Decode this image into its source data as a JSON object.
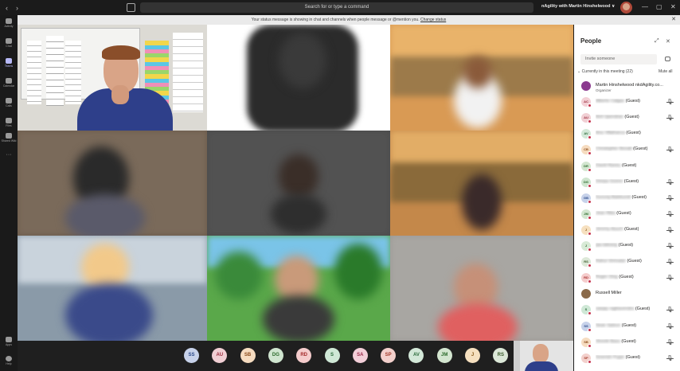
{
  "titlebar": {
    "search_placeholder": "Search for or type a command",
    "org_label": "nAgility with Martin Hinshelwood ∨",
    "back": "‹",
    "forward": "›",
    "minimize": "—",
    "maximize": "▢",
    "close": "✕"
  },
  "banner": {
    "text": "Your status message is showing in chat and channels when people message or @mention you.",
    "link": "Change status",
    "close": "✕"
  },
  "rail": [
    {
      "label": "Activity",
      "icon": "bell-icon"
    },
    {
      "label": "Chat",
      "icon": "chat-icon"
    },
    {
      "label": "Teams",
      "icon": "teams-icon"
    },
    {
      "label": "Calendar",
      "icon": "calendar-icon"
    },
    {
      "label": "Calls",
      "icon": "phone-icon"
    },
    {
      "label": "Files",
      "icon": "file-icon"
    },
    {
      "label": "Shared Wiki",
      "icon": "wiki-icon"
    },
    {
      "label": "···",
      "icon": "more-icon"
    },
    {
      "label": "Apps",
      "icon": "apps-icon"
    },
    {
      "label": "Help",
      "icon": "help-icon"
    }
  ],
  "participants_bar": [
    {
      "initials": "SS",
      "bg": "#c7d2ea",
      "fg": "#2b4a8a"
    },
    {
      "initials": "AU",
      "bg": "#f1cfd4",
      "fg": "#9b2b3c"
    },
    {
      "initials": "SB",
      "bg": "#f6dcc0",
      "fg": "#8a4a1a"
    },
    {
      "initials": "DG",
      "bg": "#cfe5cf",
      "fg": "#2a6a2a"
    },
    {
      "initials": "RD",
      "bg": "#f5cccc",
      "fg": "#a32a2a"
    },
    {
      "initials": "S",
      "bg": "#cfe8d6",
      "fg": "#2a6a3a"
    },
    {
      "initials": "SA",
      "bg": "#f3cfd9",
      "fg": "#9a2a4a"
    },
    {
      "initials": "SP",
      "bg": "#f3d0cc",
      "fg": "#a23a2a"
    },
    {
      "initials": "AV",
      "bg": "#d3e8d8",
      "fg": "#2a6a3a"
    },
    {
      "initials": "JM",
      "bg": "#d3e6d0",
      "fg": "#2a6a2a"
    },
    {
      "initials": "J",
      "bg": "#f6e0bf",
      "fg": "#8a5a1a"
    },
    {
      "initials": "RS",
      "bg": "#dce8d8",
      "fg": "#3a5a2a"
    }
  ],
  "people": {
    "title": "People",
    "invite_placeholder": "Invite someone",
    "section": "Currently in this meeting (22)",
    "mute_all": "Mute all",
    "rows": [
      {
        "initials": "",
        "name": "Martin Hinshelwood nkdAgility.co...",
        "sub": "Organizer",
        "clear": true,
        "bg": "#8b3a8f",
        "fg": "#fff",
        "mic": false
      },
      {
        "initials": "AC",
        "name": "Alberto Calgas",
        "suffix": "(Guest)",
        "bg": "#f3d0d6",
        "fg": "#9b2b3c",
        "mic": true
      },
      {
        "initials": "AU",
        "name": "Anil Upendran",
        "suffix": "(Guest)",
        "bg": "#f1cfd4",
        "fg": "#9b2b3c",
        "mic": true
      },
      {
        "initials": "AV",
        "name": "Ana Villafranca",
        "suffix": "(Guest)",
        "bg": "#d3e8d8",
        "fg": "#2a6a3a",
        "mic": false
      },
      {
        "initials": "CB",
        "name": "Christopher Bonalt",
        "suffix": "(Guest)",
        "bg": "#f6dcc0",
        "fg": "#8a4a1a",
        "mic": true
      },
      {
        "initials": "DR",
        "name": "David Raney",
        "suffix": "(Guest)",
        "bg": "#d3e6d0",
        "fg": "#2a6a2a",
        "mic": false
      },
      {
        "initials": "DG",
        "name": "Deepa Goene",
        "suffix": "(Guest)",
        "bg": "#cfe5cf",
        "fg": "#2a6a2a",
        "mic": true
      },
      {
        "initials": "GB",
        "name": "Gururaj Balekundi",
        "suffix": "(Guest)",
        "bg": "#c7d2ea",
        "fg": "#2b4a8a",
        "mic": true
      },
      {
        "initials": "JM",
        "name": "Jean Riba",
        "suffix": "(Guest)",
        "bg": "#d3e6d0",
        "fg": "#2a6a2a",
        "mic": true
      },
      {
        "initials": "J",
        "name": "Jeremy Asuch",
        "suffix": "(Guest)",
        "bg": "#f6e0bf",
        "fg": "#8a5a1a",
        "mic": true
      },
      {
        "initials": "J",
        "name": "jaa-lateang",
        "suffix": "(Guest)",
        "bg": "#d8ead6",
        "fg": "#2a6a2a",
        "mic": true
      },
      {
        "initials": "RS",
        "name": "Rahul Shrivatar",
        "suffix": "(Guest)",
        "bg": "#dce8d8",
        "fg": "#3a5a2a",
        "mic": true
      },
      {
        "initials": "RD",
        "name": "Roger Diog",
        "suffix": "(Guest)",
        "bg": "#f5cccc",
        "fg": "#a32a2a",
        "mic": true
      },
      {
        "initials": "",
        "name": "Russell Miller",
        "clear": true,
        "bg": "#8a6a4a",
        "fg": "#fff",
        "mic": false
      },
      {
        "initials": "S",
        "name": "sanjay raghavendra",
        "suffix": "(Guest)",
        "bg": "#cfe8d6",
        "fg": "#2a6a3a",
        "mic": true
      },
      {
        "initials": "SS",
        "name": "Sean Saloce",
        "suffix": "(Guest)",
        "bg": "#c7d2ea",
        "fg": "#2b4a8a",
        "mic": true
      },
      {
        "initials": "SB",
        "name": "Shonik Basu",
        "suffix": "(Guest)",
        "bg": "#f6dcc0",
        "fg": "#8a4a1a",
        "mic": true
      },
      {
        "initials": "SP",
        "name": "Sreerish Pujari",
        "suffix": "(Guest)",
        "bg": "#f3d0cc",
        "fg": "#a23a2a",
        "mic": true
      }
    ]
  }
}
